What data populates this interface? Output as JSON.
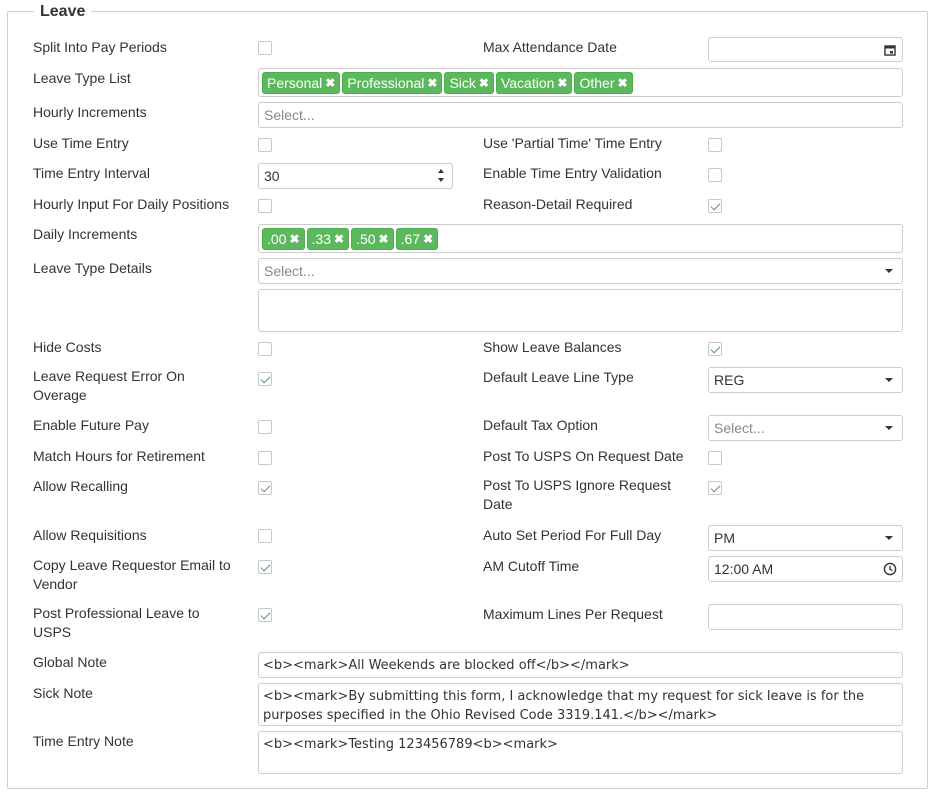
{
  "section": {
    "title": "Leave"
  },
  "labels": {
    "split_pay": "Split Into Pay Periods",
    "max_attendance": "Max Attendance Date",
    "leave_type_list": "Leave Type List",
    "hourly_increments": "Hourly Increments",
    "use_time_entry": "Use Time Entry",
    "use_partial": "Use 'Partial Time' Time Entry",
    "time_entry_interval": "Time Entry Interval",
    "enable_validation": "Enable Time Entry Validation",
    "hourly_input_daily": "Hourly Input For Daily Positions",
    "reason_detail": "Reason-Detail Required",
    "daily_increments": "Daily Increments",
    "leave_type_details": "Leave Type Details",
    "hide_costs": "Hide Costs",
    "show_balances": "Show Leave Balances",
    "error_overage_1": "Leave Request Error On",
    "error_overage_2": "Overage",
    "default_line_type": "Default Leave Line Type",
    "enable_future_pay": "Enable Future Pay",
    "default_tax": "Default Tax Option",
    "match_hours": "Match Hours for Retirement",
    "post_usps_request": "Post To USPS On Request Date",
    "allow_recalling": "Allow Recalling",
    "post_usps_ignore_1": "Post To USPS Ignore Request",
    "post_usps_ignore_2": "Date",
    "allow_requisitions": "Allow Requisitions",
    "auto_set_period": "Auto Set Period For Full Day",
    "copy_email_1": "Copy Leave Requestor Email to",
    "copy_email_2": "Vendor",
    "am_cutoff": "AM Cutoff Time",
    "post_prof_1": "Post Professional Leave to",
    "post_prof_2": "USPS",
    "max_lines": "Maximum Lines Per Request",
    "global_note": "Global Note",
    "sick_note": "Sick Note",
    "time_entry_note": "Time Entry Note"
  },
  "leave_types": [
    "Personal",
    "Professional",
    "Sick",
    "Vacation",
    "Other"
  ],
  "daily_increments": [
    ".00",
    ".33",
    ".50",
    ".67"
  ],
  "values": {
    "hourly_increments_placeholder": "Select...",
    "time_entry_interval": "30",
    "leave_type_details_placeholder": "Select...",
    "default_line_type": "REG",
    "default_tax_placeholder": "Select...",
    "auto_set_period": "PM",
    "am_cutoff": "12:00 AM",
    "max_attendance": "",
    "max_lines": ""
  },
  "checkboxes": {
    "split_pay": false,
    "use_time_entry": false,
    "use_partial": false,
    "enable_validation": false,
    "hourly_input_daily": false,
    "reason_detail": true,
    "hide_costs": false,
    "show_balances": true,
    "error_overage": true,
    "enable_future_pay": false,
    "match_hours": false,
    "post_usps_request": false,
    "allow_recalling": true,
    "post_usps_ignore": true,
    "allow_requisitions": false,
    "copy_email": true,
    "post_prof": true
  },
  "notes": {
    "global": "<b><mark>All Weekends are blocked off</b></mark>",
    "sick": "<b><mark>By submitting this form, I acknowledge that my request for sick leave is for the purposes specified in the Ohio Revised Code 3319.141.</b></mark>",
    "time_entry": "<b><mark>Testing 123456789<b><mark>"
  },
  "colors": {
    "tag_bg": "#5cb85c",
    "check": "#5a9a5a",
    "border": "#cccccc"
  }
}
